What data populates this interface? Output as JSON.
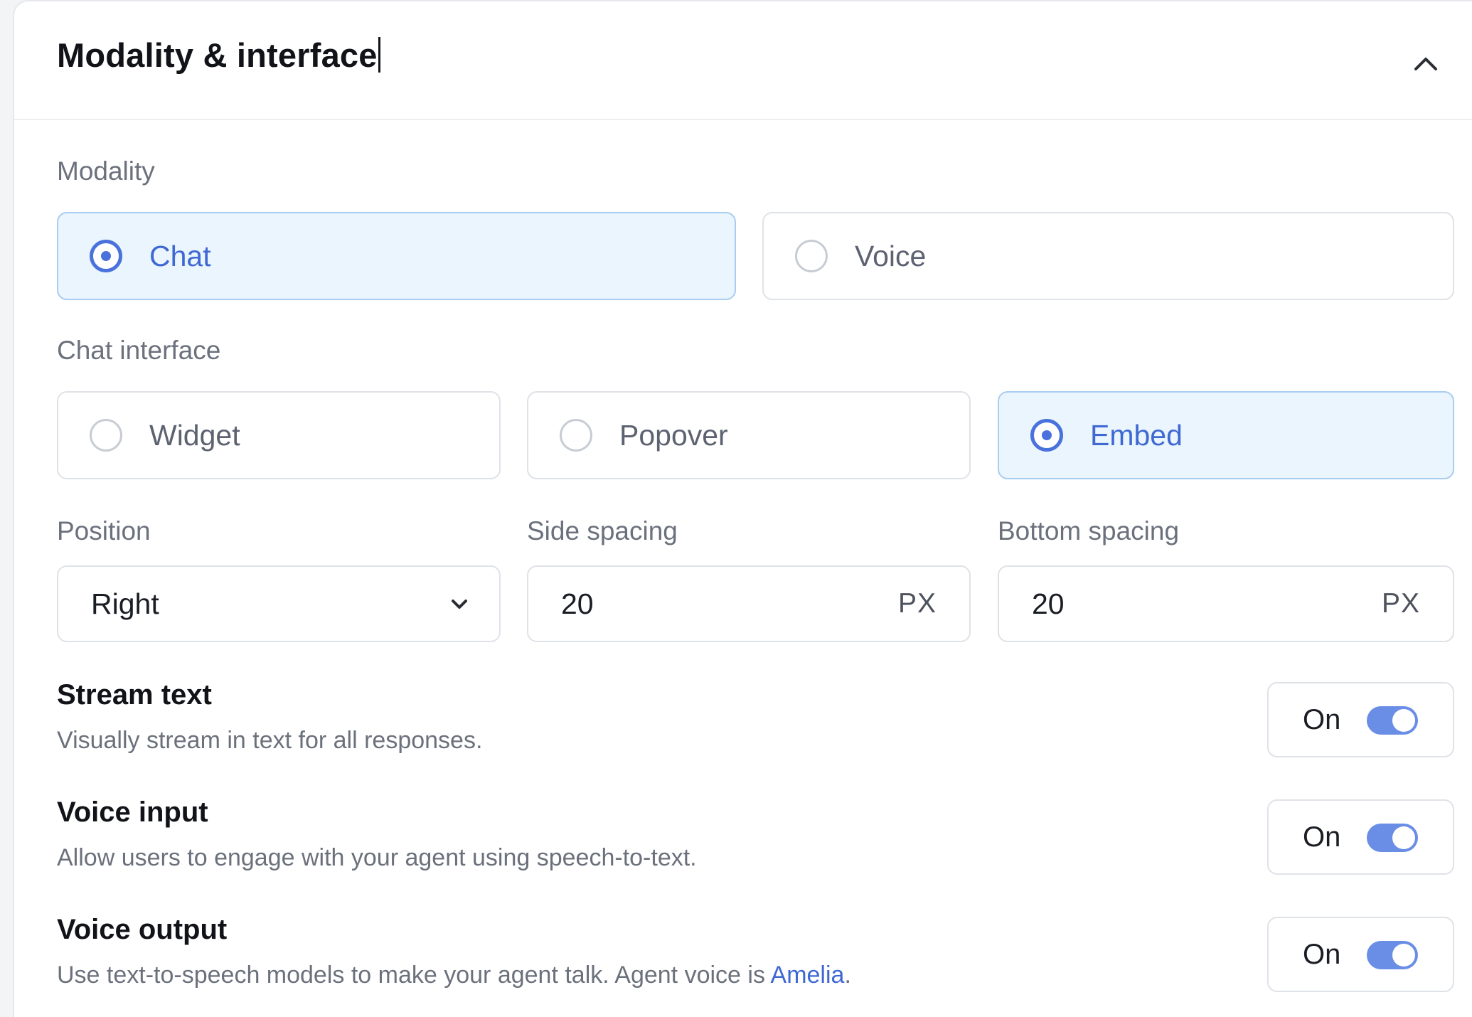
{
  "header": {
    "title": "Modality & interface",
    "collapse_icon": "chevron-up-icon"
  },
  "modality": {
    "label": "Modality",
    "options": [
      {
        "label": "Chat",
        "selected": true
      },
      {
        "label": "Voice",
        "selected": false
      }
    ]
  },
  "chat_interface": {
    "label": "Chat interface",
    "options": [
      {
        "label": "Widget",
        "selected": false
      },
      {
        "label": "Popover",
        "selected": false
      },
      {
        "label": "Embed",
        "selected": true
      }
    ]
  },
  "position": {
    "label": "Position",
    "value": "Right",
    "icon": "chevron-down-icon"
  },
  "side_spacing": {
    "label": "Side spacing",
    "value": "20",
    "unit": "PX"
  },
  "bottom_spacing": {
    "label": "Bottom spacing",
    "value": "20",
    "unit": "PX"
  },
  "settings": [
    {
      "title": "Stream text",
      "description": "Visually stream in text for all responses.",
      "toggle_label": "On",
      "enabled": true
    },
    {
      "title": "Voice input",
      "description": "Allow users to engage with your agent using speech-to-text.",
      "toggle_label": "On",
      "enabled": true
    },
    {
      "title": "Voice output",
      "description_prefix": "Use text-to-speech models to make your agent talk. Agent voice is ",
      "description_link": "Amelia",
      "description_suffix": ".",
      "toggle_label": "On",
      "enabled": true
    }
  ],
  "colors": {
    "accent": "#3f68d3",
    "selected_bg": "#eaf5fd",
    "toggle_on": "#6a8ee6"
  }
}
